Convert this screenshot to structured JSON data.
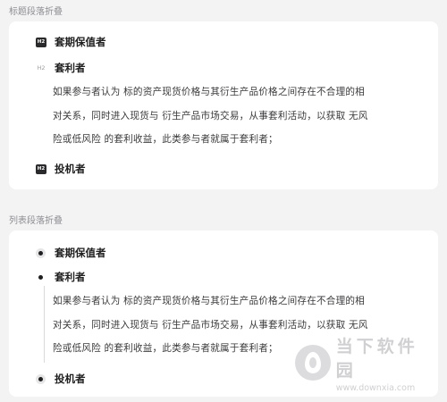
{
  "sections": {
    "heading_fold": {
      "label": "标题段落折叠",
      "items": [
        {
          "badge": "H2",
          "text": "套期保值者"
        },
        {
          "badge": "H2",
          "text": "套利者"
        },
        {
          "badge": "H2",
          "text": "投机者"
        }
      ],
      "paragraph_lines": [
        "如果参与者认为 标的资产现货价格与其衍生产品价格之间存在不合理的相",
        "对关系，同时进入现货与 衍生产品市场交易，从事套利活动，以获取 无风",
        "险或低风险 的套利收益，此类参与者就属于套利者；"
      ]
    },
    "list_fold": {
      "label": "列表段落折叠",
      "items": [
        {
          "text": "套期保值者"
        },
        {
          "text": "套利者"
        },
        {
          "text": "投机者"
        }
      ],
      "paragraph_lines": [
        "如果参与者认为 标的资产现货价格与其衍生产品价格之间存在不合理的相",
        "对关系，同时进入现货与 衍生产品市场交易，从事套利活动，以获取 无风",
        "险或低风险 的套利收益，此类参与者就属于套利者；"
      ]
    }
  },
  "watermark": {
    "title": "当下软件园",
    "url": "www.downxia.com"
  }
}
